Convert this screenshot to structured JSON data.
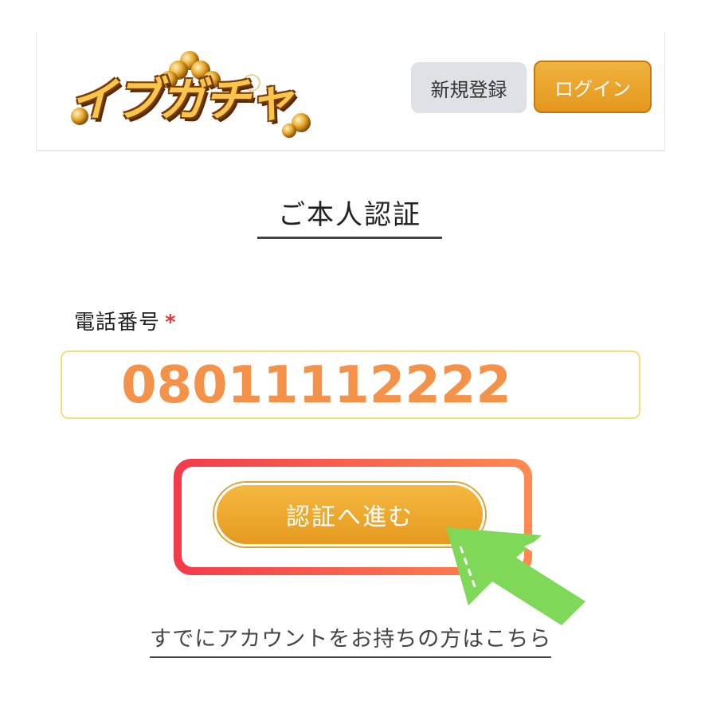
{
  "header": {
    "logo_text": "イブガチャ",
    "register_label": "新規登録",
    "login_label": "ログイン"
  },
  "page": {
    "title": "ご本人認証"
  },
  "form": {
    "phone_label": "電話番号",
    "required_mark": "*",
    "phone_value": "08011112222"
  },
  "actions": {
    "submit_label": "認証へ進む",
    "existing_account_link": "すでにアカウントをお持ちの方はこちら"
  },
  "colors": {
    "accent_orange": "#e5971c",
    "phone_text": "#f4924a",
    "highlight_red": "#f33a4a",
    "pointer_green": "#7fd858"
  },
  "icons": {
    "pointer": "green-arrow-pointer-icon"
  }
}
